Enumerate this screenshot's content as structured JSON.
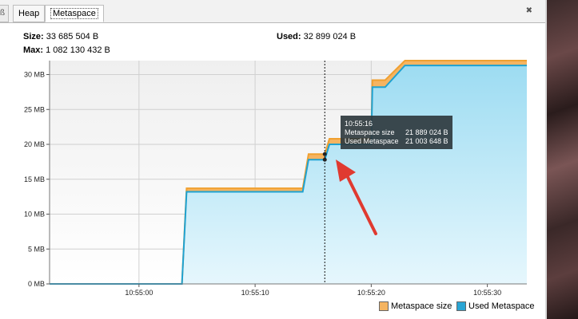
{
  "tabs": {
    "edge_glyph": "ß",
    "heap_label": "Heap",
    "metaspace_label": "Metaspace",
    "close_glyph": "✖"
  },
  "stats": {
    "size_label": "Size:",
    "size_value": "33 685 504 B",
    "max_label": "Max:",
    "max_value": "1 082 130 432 B",
    "used_label": "Used:",
    "used_value": "32 899 024 B"
  },
  "tooltip": {
    "time": "10:55:16",
    "row1_label": "Metaspace size",
    "row1_value": "21 889 024 B",
    "row2_label": "Used Metaspace",
    "row2_value": "21 003 648 B"
  },
  "colors": {
    "size_fill": "#f5b461",
    "size_line": "#f0a030",
    "used_fill": "#a9e1f4",
    "used_line": "#1ea2d2",
    "arrow": "#e03a30"
  },
  "chart_data": {
    "type": "area",
    "ylim": [
      0,
      32
    ],
    "yticks": [
      0,
      5,
      10,
      15,
      20,
      25,
      30
    ],
    "ytick_labels": [
      "0 MB",
      "5 MB",
      "10 MB",
      "15 MB",
      "20 MB",
      "25 MB",
      "30 MB"
    ],
    "xticks": [
      0,
      10,
      20,
      30
    ],
    "xtick_labels": [
      "10:55:00",
      "10:55:10",
      "10:55:20",
      "10:55:30"
    ],
    "xlim": [
      -7.7,
      33.4
    ],
    "grid": true,
    "legend_placement": "bottom-right",
    "crosshair_x": 16,
    "series": [
      {
        "name": "Metaspace size",
        "x": [
          -7.7,
          3.7,
          4.1,
          14.1,
          14.6,
          16.0,
          16.4,
          20.0,
          20.1,
          21.2,
          22.9,
          23.4,
          33.4
        ],
        "values": [
          0,
          0,
          13.7,
          13.7,
          18.6,
          18.6,
          20.8,
          20.8,
          29.2,
          29.2,
          32.0,
          32.0,
          32.0
        ]
      },
      {
        "name": "Used Metaspace",
        "x": [
          -7.7,
          3.7,
          4.1,
          14.1,
          14.6,
          16.0,
          16.4,
          20.0,
          20.1,
          21.2,
          22.9,
          23.4,
          33.4
        ],
        "values": [
          0,
          0,
          13.2,
          13.2,
          17.8,
          17.8,
          20.0,
          20.0,
          28.2,
          28.2,
          31.3,
          31.3,
          31.3
        ]
      }
    ]
  }
}
